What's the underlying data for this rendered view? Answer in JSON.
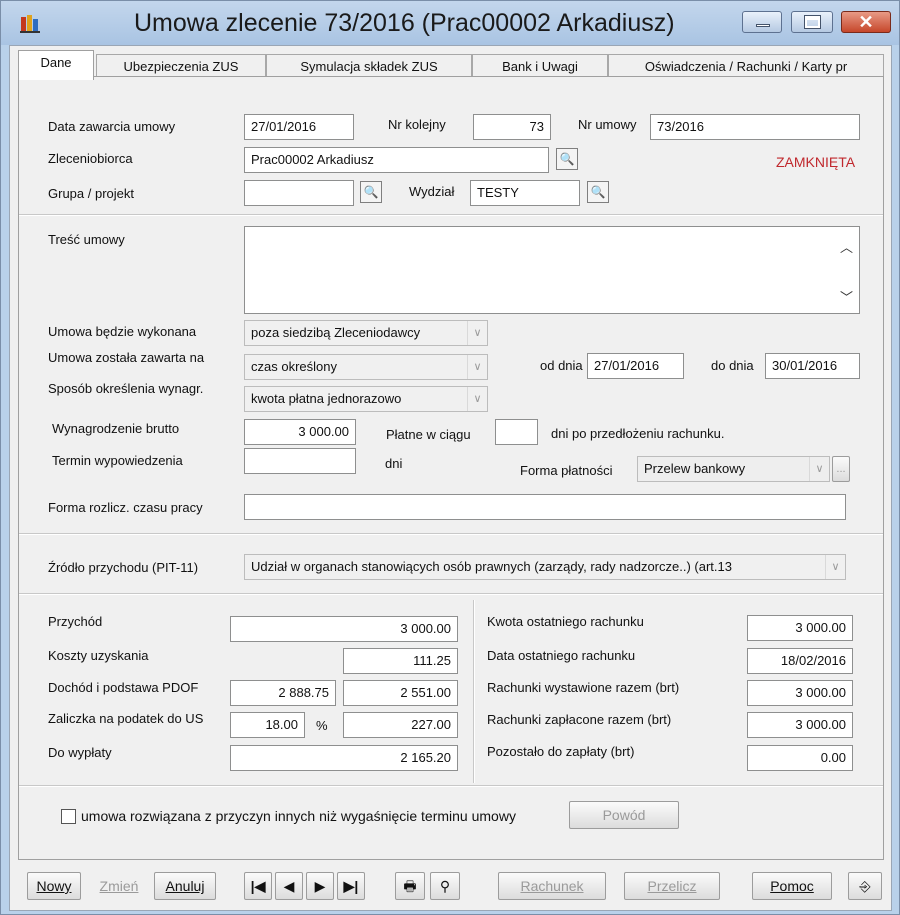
{
  "window": {
    "title": "Umowa zlecenie 73/2016 (Prac00002 Arkadiusz)"
  },
  "tabs": [
    "Dane",
    "Ubezpieczenia ZUS",
    "Symulacja składek ZUS",
    "Bank i Uwagi",
    "Oświadczenia / Rachunki / Karty pr"
  ],
  "header": {
    "data_zawarcia_label": "Data zawarcia umowy",
    "data_zawarcia": "27/01/2016",
    "nr_kolejny_label": "Nr kolejny",
    "nr_kolejny": "73",
    "nr_umowy_label": "Nr umowy",
    "nr_umowy": "73/2016",
    "zleceniobiorca_label": "Zleceniobiorca",
    "zleceniobiorca": "Prac00002 Arkadiusz",
    "status": "ZAMKNIĘTA",
    "grupa_label": "Grupa / projekt",
    "grupa": "",
    "wydzial_label": "Wydział",
    "wydzial": "TESTY"
  },
  "details": {
    "tresc_label": "Treść umowy",
    "tresc": "",
    "wykonana_label": "Umowa będzie wykonana",
    "wykonana": "poza siedzibą Zleceniodawcy",
    "zawarta_label": "Umowa została zawarta na",
    "zawarta": "czas określony",
    "od_dnia_label": "od dnia",
    "od_dnia": "27/01/2016",
    "do_dnia_label": "do dnia",
    "do_dnia": "30/01/2016",
    "sposob_label": "Sposób określenia wynagr.",
    "sposob": "kwota płatna jednorazowo",
    "wynagrodzenie_label": "Wynagrodzenie brutto",
    "wynagrodzenie": "3 000.00",
    "platne_label": "Płatne w ciągu",
    "platne": "",
    "dni_po_label": "dni po przedłożeniu rachunku.",
    "termin_label": "Termin wypowiedzenia",
    "termin": "",
    "dni_label": "dni",
    "forma_platnosci_label": "Forma płatności",
    "forma_platnosci": "Przelew bankowy",
    "forma_rozlicz_label": "Forma rozlicz. czasu pracy",
    "forma_rozlicz": ""
  },
  "source": {
    "label": "Źródło przychodu (PIT-11)",
    "value": "Udział w organach stanowiących osób prawnych (zarządy, rady nadzorcze..) (art.13"
  },
  "summary_left": {
    "przychod_label": "Przychód",
    "przychod": "3 000.00",
    "koszty_label": "Koszty uzyskania",
    "koszty": "111.25",
    "dochod_label": "Dochód i podstawa PDOF",
    "dochod": "2 888.75",
    "podstawa": "2 551.00",
    "zaliczka_label": "Zaliczka na podatek do US",
    "zaliczka_proc": "18.00",
    "proc_sign": "%",
    "zaliczka": "227.00",
    "do_wyplaty_label": "Do wypłaty",
    "do_wyplaty": "2 165.20"
  },
  "summary_right": {
    "kwota_label": "Kwota ostatniego rachunku",
    "kwota": "3 000.00",
    "data_label": "Data ostatniego rachunku",
    "data": "18/02/2016",
    "wystawione_label": "Rachunki wystawione razem (brt)",
    "wystawione": "3 000.00",
    "zaplacone_label": "Rachunki zapłacone razem (brt)",
    "zaplacone": "3 000.00",
    "pozostalo_label": "Pozostało do zapłaty (brt)",
    "pozostalo": "0.00"
  },
  "termination": {
    "label": "umowa rozwiązana z przyczyn innych niż wygaśnięcie terminu umowy",
    "button": "Powód"
  },
  "toolbar": {
    "nowy": "Nowy",
    "zmien": "Zmień",
    "anuluj": "Anuluj",
    "rachunek": "Rachunek",
    "przelicz": "Przelicz",
    "pomoc": "Pomoc"
  },
  "colors": {
    "status": "#c0282d",
    "titlebar": "#b9d1ea",
    "close": "#c6472b"
  },
  "icons": [
    "app-icon",
    "minimize-icon",
    "maximize-icon",
    "close-icon",
    "picker-icon",
    "first-record-icon",
    "prev-record-icon",
    "next-record-icon",
    "last-record-icon",
    "print-icon",
    "search-binoculars-icon",
    "exit-door-icon",
    "scroll-up-icon",
    "scroll-down-icon",
    "dropdown-arrow-icon"
  ]
}
